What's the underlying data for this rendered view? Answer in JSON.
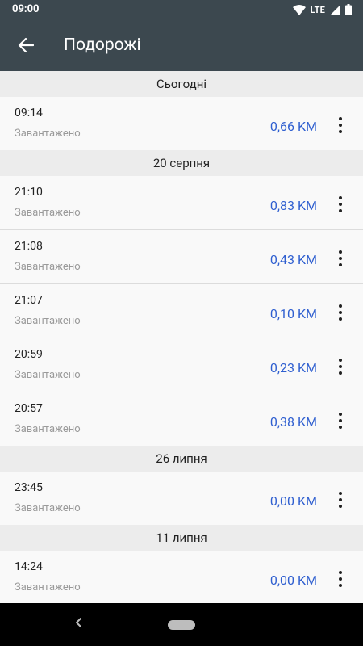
{
  "status_bar": {
    "time": "09:00",
    "network": "LTE"
  },
  "app_bar": {
    "title": "Подорожі"
  },
  "sections": [
    {
      "header": "Сьогодні",
      "trips": [
        {
          "time": "09:14",
          "status": "Завантажено",
          "distance": "0,66 KM"
        }
      ]
    },
    {
      "header": "20 серпня",
      "trips": [
        {
          "time": "21:10",
          "status": "Завантажено",
          "distance": "0,83 KM"
        },
        {
          "time": "21:08",
          "status": "Завантажено",
          "distance": "0,43 KM"
        },
        {
          "time": "21:07",
          "status": "Завантажено",
          "distance": "0,10 KM"
        },
        {
          "time": "20:59",
          "status": "Завантажено",
          "distance": "0,23 KM"
        },
        {
          "time": "20:57",
          "status": "Завантажено",
          "distance": "0,38 KM"
        }
      ]
    },
    {
      "header": "26 липня",
      "trips": [
        {
          "time": "23:45",
          "status": "Завантажено",
          "distance": "0,00 KM"
        }
      ]
    },
    {
      "header": "11 липня",
      "trips": [
        {
          "time": "14:24",
          "status": "Завантажено",
          "distance": "0,00 KM"
        }
      ]
    }
  ],
  "colors": {
    "app_bar": "#3c484f",
    "distance": "#2f5fd0",
    "section_bg": "#ececec",
    "row_bg": "#f9f9f9"
  },
  "icons": {
    "back": "arrow-left-icon",
    "more": "more-vert-icon",
    "wifi": "wifi-icon",
    "signal": "signal-icon",
    "battery": "battery-icon"
  }
}
